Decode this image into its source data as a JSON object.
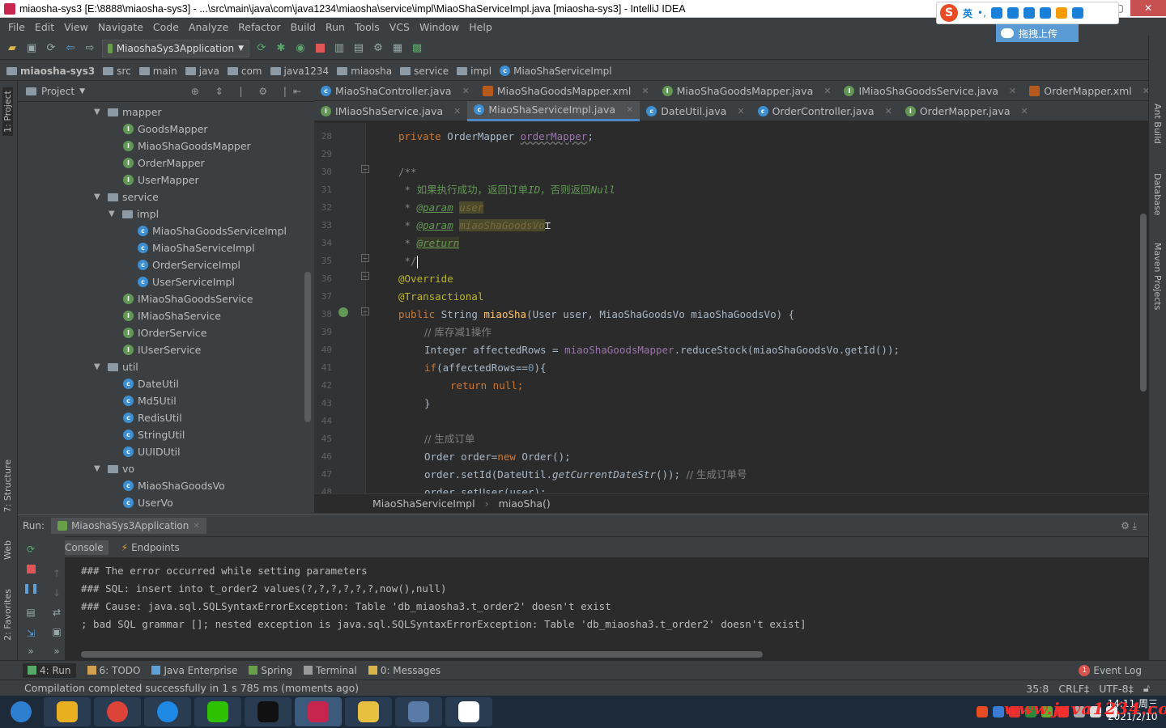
{
  "window": {
    "title": "miaosha-sys3 [E:\\8888\\miaosha-sys3] - ...\\src\\main\\java\\com\\java1234\\miaosha\\service\\impl\\MiaoShaServiceImpl.java [miaosha-sys3] - IntelliJ IDEA",
    "minimize": "—",
    "maximize": "▢",
    "close": "✕"
  },
  "ime": {
    "logo": "S",
    "lang": "英",
    "punct": "•,",
    "upload": "拖拽上传"
  },
  "menu": [
    "File",
    "Edit",
    "View",
    "Navigate",
    "Code",
    "Analyze",
    "Refactor",
    "Build",
    "Run",
    "Tools",
    "VCS",
    "Window",
    "Help"
  ],
  "toolbar": {
    "run_config": "MiaoshaSys3Application"
  },
  "breadcrumbs": [
    "miaosha-sys3",
    "src",
    "main",
    "java",
    "com",
    "java1234",
    "miaosha",
    "service",
    "impl",
    "MiaoShaServiceImpl"
  ],
  "project": {
    "header": "Project",
    "tree": [
      {
        "label": "mapper",
        "type": "folder",
        "depth": 0,
        "open": true
      },
      {
        "label": "GoodsMapper",
        "type": "interface",
        "depth": 1
      },
      {
        "label": "MiaoShaGoodsMapper",
        "type": "interface",
        "depth": 1
      },
      {
        "label": "OrderMapper",
        "type": "interface",
        "depth": 1
      },
      {
        "label": "UserMapper",
        "type": "interface",
        "depth": 1
      },
      {
        "label": "service",
        "type": "folder",
        "depth": 0,
        "open": true
      },
      {
        "label": "impl",
        "type": "folder",
        "depth": 1,
        "open": true
      },
      {
        "label": "MiaoShaGoodsServiceImpl",
        "type": "class",
        "depth": 2
      },
      {
        "label": "MiaoShaServiceImpl",
        "type": "class",
        "depth": 2
      },
      {
        "label": "OrderServiceImpl",
        "type": "class",
        "depth": 2
      },
      {
        "label": "UserServiceImpl",
        "type": "class",
        "depth": 2
      },
      {
        "label": "IMiaoShaGoodsService",
        "type": "interface",
        "depth": 1
      },
      {
        "label": "IMiaoShaService",
        "type": "interface",
        "depth": 1
      },
      {
        "label": "IOrderService",
        "type": "interface",
        "depth": 1
      },
      {
        "label": "IUserService",
        "type": "interface",
        "depth": 1
      },
      {
        "label": "util",
        "type": "folder",
        "depth": 0,
        "open": true
      },
      {
        "label": "DateUtil",
        "type": "class",
        "depth": 1
      },
      {
        "label": "Md5Util",
        "type": "class",
        "depth": 1
      },
      {
        "label": "RedisUtil",
        "type": "class",
        "depth": 1
      },
      {
        "label": "StringUtil",
        "type": "class",
        "depth": 1
      },
      {
        "label": "UUIDUtil",
        "type": "class",
        "depth": 1
      },
      {
        "label": "vo",
        "type": "folder",
        "depth": 0,
        "open": true
      },
      {
        "label": "MiaoShaGoodsVo",
        "type": "class",
        "depth": 1
      },
      {
        "label": "UserVo",
        "type": "class",
        "depth": 1
      }
    ]
  },
  "tabs_row1": [
    {
      "label": "MiaoShaController.java",
      "type": "class"
    },
    {
      "label": "MiaoShaGoodsMapper.xml",
      "type": "xml"
    },
    {
      "label": "MiaoShaGoodsMapper.java",
      "type": "interface"
    },
    {
      "label": "IMiaoShaGoodsService.java",
      "type": "interface"
    },
    {
      "label": "OrderMapper.xml",
      "type": "xml"
    }
  ],
  "tabs_row2": [
    {
      "label": "IMiaoShaService.java",
      "type": "interface"
    },
    {
      "label": "MiaoShaServiceImpl.java",
      "type": "class",
      "active": true
    },
    {
      "label": "DateUtil.java",
      "type": "class"
    },
    {
      "label": "OrderController.java",
      "type": "class"
    },
    {
      "label": "OrderMapper.java",
      "type": "interface"
    }
  ],
  "code": {
    "line_numbers": [
      "28",
      "29",
      "30",
      "31",
      "32",
      "33",
      "34",
      "35",
      "36",
      "37",
      "38",
      "39",
      "40",
      "41",
      "42",
      "43",
      "44",
      "45",
      "46",
      "47",
      "48"
    ],
    "l28_kw": "private ",
    "l28_type": "OrderMapper ",
    "l28_field": "orderMapper",
    "l28_end": ";",
    "l30": "/**",
    "l31_star": " * ",
    "l31_text": "如果执行成功，返回订单",
    "l31_id": "ID",
    "l31_text2": "，否则返回",
    "l31_null": "Null",
    "l32_star": " * ",
    "l32_tag": "@param",
    "l32_arg": "user",
    "l33_star": " * ",
    "l33_tag": "@param",
    "l33_arg": "miaoShaGoodsVo",
    "l34_star": " * ",
    "l34_tag": "@return",
    "l35": " */",
    "l36": "@Override",
    "l37": "@Transactional",
    "l38_kw": "public ",
    "l38_type": "String ",
    "l38_fn": "miaoSha",
    "l38_rest": "(User user, MiaoShaGoodsVo miaoShaGoodsVo) {",
    "l39": "// 库存减1操作",
    "l40_a": "Integer affectedRows = ",
    "l40_f": "miaoShaGoodsMapper",
    "l40_b": ".reduceStock(miaoShaGoodsVo.getId());",
    "l41_kw": "if",
    "l41_a": "(affectedRows==",
    "l41_n": "0",
    "l41_b": "){",
    "l42_kw": "return null",
    ";": ";",
    "l43": "}",
    "l45": "// 生成订单",
    "l46_a": "Order order=",
    "l46_kw": "new ",
    "l46_b": "Order();",
    "l47_a": "order.setId(DateUtil.",
    "l47_fn": "getCurrentDateStr",
    "l47_b": "()); ",
    "l47_c": "// 生成订单号",
    "l48": "order.setUser(user);"
  },
  "editor_breadcrumb": [
    "MiaoShaServiceImpl",
    "miaoSha()"
  ],
  "run": {
    "label": "Run:",
    "config": "MiaoshaSys3Application",
    "subtabs": [
      "Console",
      "Endpoints"
    ],
    "console": [
      "### The error occurred while setting parameters",
      "### SQL: insert into t_order2 values(?,?,?,?,?,?,now(),null)",
      "### Cause: java.sql.SQLSyntaxErrorException: Table 'db_miaosha3.t_order2' doesn't exist",
      "; bad SQL grammar []; nested exception is java.sql.SQLSyntaxErrorException: Table 'db_miaosha3.t_order2' doesn't exist]"
    ]
  },
  "bottom_tools": [
    "4: Run",
    "6: TODO",
    "Java Enterprise",
    "Spring",
    "Terminal",
    "0: Messages"
  ],
  "event_log": "Event Log",
  "event_count": "1",
  "status": {
    "message": "Compilation completed successfully in 1 s 785 ms (moments ago)",
    "position": "35:8",
    "line_sep": "CRLF‡",
    "encoding": "UTF-8‡"
  },
  "side_labels": {
    "project": "1: Project",
    "structure": "7: Structure",
    "web": "Web",
    "favorites": "2: Favorites",
    "ant": "Ant Build",
    "database": "Database",
    "maven": "Maven Projects"
  },
  "clock": {
    "time": "14:11 周三",
    "date": "2021/2/10"
  },
  "watermark": "www.java1234.com",
  "colors": {
    "bg": "#2b2b2b",
    "panel": "#3c3f41",
    "keyword": "#cc7832",
    "comment": "#629755",
    "field": "#9876aa",
    "accent": "#4a88c7"
  }
}
